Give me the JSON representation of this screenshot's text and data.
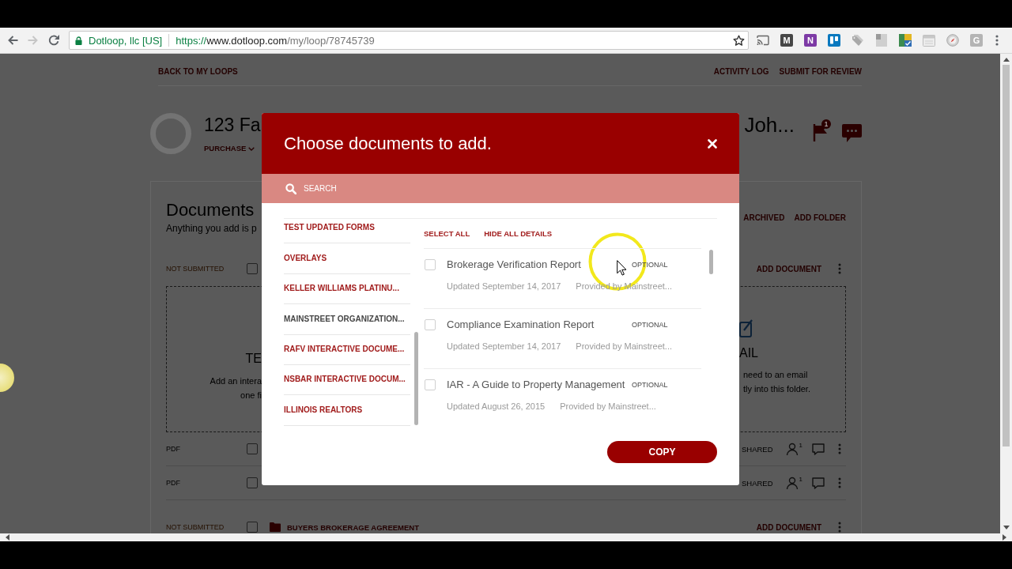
{
  "browser": {
    "nav": [
      {
        "kind": "back",
        "disabled": false
      },
      {
        "kind": "forward",
        "disabled": true
      },
      {
        "kind": "reload",
        "disabled": false
      }
    ],
    "site_identity": "Dotloop, llc [US]",
    "url": {
      "scheme": "https://",
      "host": "www.dotloop.com",
      "path": "/my/loop/78745739"
    },
    "extensions": [
      {
        "kind": "cast"
      },
      {
        "kind": "letter-dark",
        "label": "M"
      },
      {
        "kind": "letter-purple",
        "label": "N"
      },
      {
        "kind": "board"
      },
      {
        "kind": "tag"
      },
      {
        "kind": "panel"
      },
      {
        "kind": "sheet"
      },
      {
        "kind": "calendar"
      },
      {
        "kind": "compass"
      },
      {
        "kind": "letter-light",
        "label": "G"
      }
    ]
  },
  "page": {
    "back_link": "BACK TO MY LOOPS",
    "top_links": [
      "ACTIVITY LOG",
      "SUBMIT FOR REVIEW"
    ],
    "loop_title": "123 Fa",
    "loop_type": "PURCHASE",
    "loop_title_right": "Joh...",
    "flag_badge": "1",
    "documents": {
      "heading": "Documents",
      "subtitle": "Anything you add is p",
      "actions": [
        "ARCHIVED",
        "ADD FOLDER"
      ]
    },
    "rows": [
      {
        "kind": "folder",
        "status": "NOT SUBMITTED",
        "checked": false,
        "action": "ADD DOCUMENT"
      },
      {
        "kind": "dropzone",
        "left": {
          "title": "TE",
          "lines": [
            "Add an intera",
            "one fi"
          ]
        },
        "right": {
          "title": "AIL",
          "lines": [
            "need to an email",
            "tly into this folder."
          ]
        }
      },
      {
        "kind": "document",
        "type": "PDF",
        "checked": false,
        "sharing": "SHARED",
        "shared_count": "1"
      },
      {
        "kind": "document",
        "type": "PDF",
        "checked": false,
        "sharing": "SHARED",
        "shared_count": "1"
      },
      {
        "kind": "folder",
        "status": "NOT SUBMITTED",
        "checked": false,
        "name": "BUYERS BROKERAGE AGREEMENT",
        "action": "ADD DOCUMENT"
      }
    ]
  },
  "modal": {
    "title": "Choose documents to add.",
    "search": {
      "placeholder": "SEARCH"
    },
    "sources": [
      {
        "label": "TEST UPDATED FORMS",
        "selected": false
      },
      {
        "label": "OVERLAYS",
        "selected": false
      },
      {
        "label": "KELLER WILLIAMS PLATINU...",
        "selected": false
      },
      {
        "label": "MAINSTREET ORGANIZATION...",
        "selected": true
      },
      {
        "label": "RAFV INTERACTIVE DOCUME...",
        "selected": false
      },
      {
        "label": "NSBAR INTERACTIVE DOCUM...",
        "selected": false
      },
      {
        "label": "ILLINOIS REALTORS",
        "selected": false
      }
    ],
    "actions": [
      "SELECT ALL",
      "HIDE ALL DETAILS"
    ],
    "documents": [
      {
        "title": "Brokerage Verification Report",
        "tag": "OPTIONAL",
        "updated": "Updated September 14, 2017",
        "provider": "Provided by Mainstreet...",
        "checked": false
      },
      {
        "title": "Compliance Examination Report",
        "tag": "OPTIONAL",
        "updated": "Updated September 14, 2017",
        "provider": "Provided by Mainstreet...",
        "checked": false
      },
      {
        "title": "IAR - A Guide to Property Management",
        "tag": "OPTIONAL",
        "updated": "Updated August 26, 2015",
        "provider": "Provided by Mainstreet...",
        "checked": false
      }
    ],
    "submit": "COPY"
  }
}
